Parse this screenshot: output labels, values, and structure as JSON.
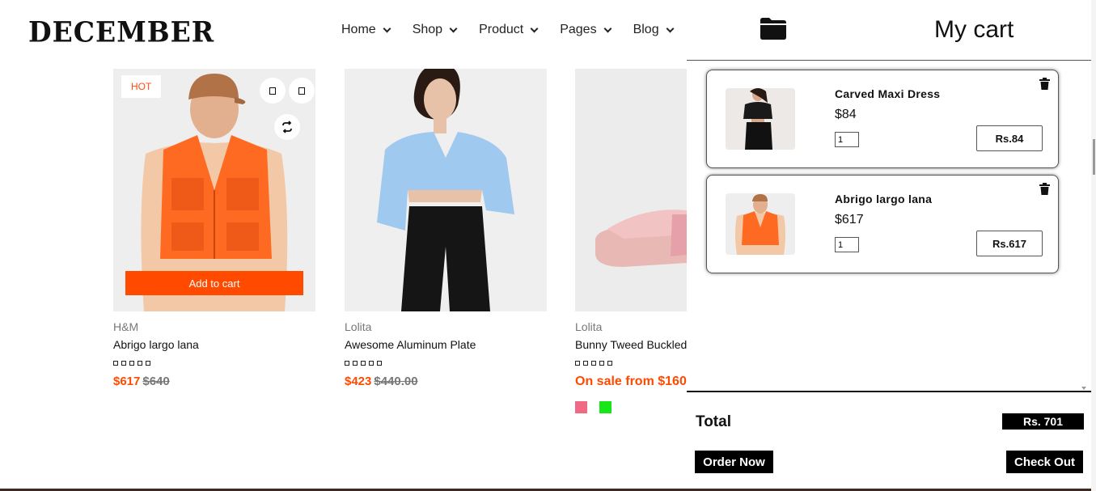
{
  "header": {
    "logo": "DECEMBER",
    "nav": [
      {
        "label": "Home"
      },
      {
        "label": "Shop"
      },
      {
        "label": "Product"
      },
      {
        "label": "Pages"
      },
      {
        "label": "Blog"
      }
    ]
  },
  "products": [
    {
      "badge": "HOT",
      "brand": "H&M",
      "name": "Abrigo largo lana",
      "price": "$617",
      "old_price": "$640",
      "add_to_cart": "Add to cart"
    },
    {
      "brand": "Lolita",
      "name": "Awesome Aluminum Plate",
      "price": "$423",
      "old_price": "$440.00"
    },
    {
      "brand": "Lolita",
      "name": "Bunny Tweed Buckled",
      "price": "On sale from $160",
      "swatches": [
        "#f06a86",
        "#19e619"
      ]
    }
  ],
  "cart": {
    "title": "My cart",
    "items": [
      {
        "name": "Carved Maxi Dress",
        "price": "$84",
        "qty": "1",
        "subtotal": "Rs.84"
      },
      {
        "name": "Abrigo largo lana",
        "price": "$617",
        "qty": "1",
        "subtotal": "Rs.617"
      }
    ],
    "total_label": "Total",
    "total_value": "Rs. 701",
    "order_now": "Order Now",
    "check_out": "Check Out"
  },
  "colors": {
    "accent": "#ff4a00",
    "cart_dark": "#000000"
  }
}
